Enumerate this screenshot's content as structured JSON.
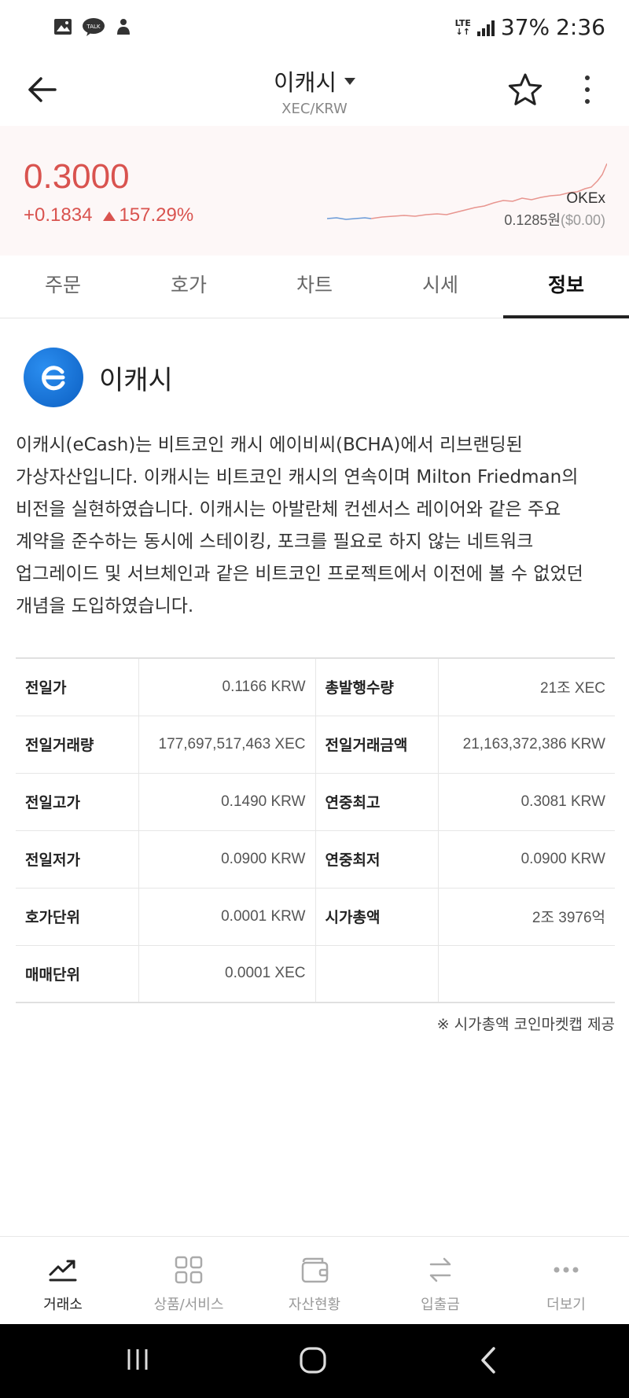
{
  "status_bar": {
    "battery": "37%",
    "time": "2:36",
    "network": "LTE"
  },
  "header": {
    "title": "이캐시",
    "pair": "XEC/KRW"
  },
  "price": {
    "current": "0.3000",
    "change": "+0.1834",
    "change_pct": "157.29%",
    "exchange": "OKEx",
    "ref_price": "0.1285원",
    "ref_usd": "($0.00)",
    "up_color": "#d9534f"
  },
  "tabs": [
    {
      "label": "주문",
      "active": false
    },
    {
      "label": "호가",
      "active": false
    },
    {
      "label": "차트",
      "active": false
    },
    {
      "label": "시세",
      "active": false
    },
    {
      "label": "정보",
      "active": true
    }
  ],
  "coin": {
    "name": "이캐시",
    "logo_icon": "ecash-logo",
    "description": "이캐시(eCash)는 비트코인 캐시 에이비씨(BCHA)에서 리브랜딩된 가상자산입니다. 이캐시는 비트코인 캐시의 연속이며 Milton Friedman의 비전을 실현하였습니다. 이캐시는 아발란체 컨센서스 레이어와 같은 주요 계약을 준수하는 동시에 스테이킹, 포크를 필요로 하지 않는 네트워크 업그레이드 및 서브체인과 같은 비트코인 프로젝트에서 이전에 볼 수 없었던 개념을 도입하였습니다."
  },
  "info_rows": [
    {
      "l1": "전일가",
      "v1": "0.1166 KRW",
      "l2": "총발행수량",
      "v2": "21조 XEC"
    },
    {
      "l1": "전일거래량",
      "v1": "177,697,517,463 XEC",
      "l2": "전일거래금액",
      "v2": "21,163,372,386 KRW"
    },
    {
      "l1": "전일고가",
      "v1": "0.1490 KRW",
      "l2": "연중최고",
      "v2": "0.3081 KRW"
    },
    {
      "l1": "전일저가",
      "v1": "0.0900 KRW",
      "l2": "연중최저",
      "v2": "0.0900 KRW"
    },
    {
      "l1": "호가단위",
      "v1": "0.0001 KRW",
      "l2": "시가총액",
      "v2": "2조 3976억"
    },
    {
      "l1": "매매단위",
      "v1": "0.0001 XEC",
      "l2": "",
      "v2": ""
    }
  ],
  "footnote": "※ 시가총액 코인마켓캡 제공",
  "bottom_nav": [
    {
      "label": "거래소",
      "icon": "trend-chart-icon",
      "active": true
    },
    {
      "label": "상품/서비스",
      "icon": "grid-icon",
      "active": false
    },
    {
      "label": "자산현황",
      "icon": "wallet-icon",
      "active": false
    },
    {
      "label": "입출금",
      "icon": "transfer-arrows-icon",
      "active": false
    },
    {
      "label": "더보기",
      "icon": "more-dots-icon",
      "active": false
    }
  ]
}
